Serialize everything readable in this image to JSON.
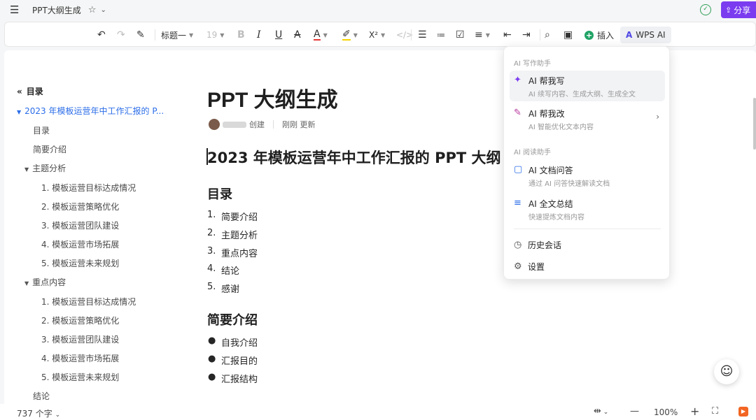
{
  "titlebar": {
    "doc_title": "PPT大纲生成",
    "share_label": "分享"
  },
  "toolbar": {
    "heading_style": "标题一",
    "font_size": "19",
    "superscript": "X²",
    "insert_label": "插入",
    "wps_ai_label": "WPS AI"
  },
  "outline": {
    "header": "目录",
    "items": [
      {
        "label": "2023 年模板运营年中工作汇报的 P..."
      },
      {
        "label": "目录"
      },
      {
        "label": "简要介绍"
      },
      {
        "label": "主题分析"
      },
      {
        "label": "1. 模板运营目标达成情况"
      },
      {
        "label": "2. 模板运营策略优化"
      },
      {
        "label": "3. 模板运营团队建设"
      },
      {
        "label": "4. 模板运营市场拓展"
      },
      {
        "label": "5. 模板运营未来规划"
      },
      {
        "label": "重点内容"
      },
      {
        "label": "1. 模板运营目标达成情况"
      },
      {
        "label": "2. 模板运营策略优化"
      },
      {
        "label": "3. 模板运营团队建设"
      },
      {
        "label": "4. 模板运营市场拓展"
      },
      {
        "label": "5. 模板运营未来规划"
      },
      {
        "label": "结论"
      }
    ]
  },
  "doc": {
    "title": "PPT 大纲生成",
    "meta_created": "创建",
    "meta_updated": "刚刚 更新",
    "heading1": "2023 年模板运营年中工作汇报的 PPT 大纲",
    "toc_heading": "目录",
    "toc_items": [
      {
        "num": "1.",
        "text": "简要介绍"
      },
      {
        "num": "2.",
        "text": "主题分析"
      },
      {
        "num": "3.",
        "text": "重点内容"
      },
      {
        "num": "4.",
        "text": "结论"
      },
      {
        "num": "5.",
        "text": "感谢"
      }
    ],
    "intro_heading": "简要介绍",
    "intro_items": [
      "自我介绍",
      "汇报目的",
      "汇报结构"
    ]
  },
  "ai_menu": {
    "section_write": "AI 写作助手",
    "help_write_title": "AI 帮我写",
    "help_write_desc": "AI 续写内容、生成大纲、生成全文",
    "help_edit_title": "AI 帮我改",
    "help_edit_desc": "AI 智能优化文本内容",
    "section_read": "AI 阅读助手",
    "qa_title": "AI 文档问答",
    "qa_desc": "通过 AI 问答快速解读文档",
    "summary_title": "AI 全文总结",
    "summary_desc": "快速提炼文档内容",
    "history": "历史会话",
    "settings": "设置"
  },
  "bottombar": {
    "word_count": "737 个字",
    "zoom": "100%"
  },
  "colors": {
    "accent": "#7b3cf0",
    "link": "#2b6de8",
    "insert_green": "#21a366"
  }
}
